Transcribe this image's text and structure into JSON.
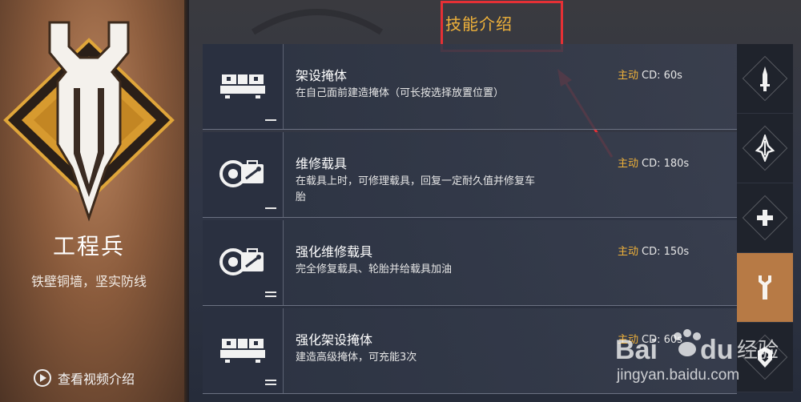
{
  "class_panel": {
    "name": "工程兵",
    "slogan": "铁壁铜墙，坚实防线",
    "video_link": "查看视频介绍"
  },
  "section_title": "技能介绍",
  "skills": [
    {
      "name": "架设掩体",
      "description": "在自己面前建造掩体（可长按选择放置位置）",
      "type": "主动",
      "cd": "CD: 60s",
      "icon": "barrier-icon",
      "level_marks": 1
    },
    {
      "name": "维修载具",
      "description": "在载具上时，可修理载具，回复一定耐久值并修复车胎",
      "type": "主动",
      "cd": "CD: 180s",
      "icon": "repair-kit-icon",
      "level_marks": 1
    },
    {
      "name": "强化维修载具",
      "description": "完全修复载具、轮胎并给载具加油",
      "type": "主动",
      "cd": "CD: 150s",
      "icon": "repair-kit-icon",
      "level_marks": 2
    },
    {
      "name": "强化架设掩体",
      "description": "建造高级掩体，可充能3次",
      "type": "主动",
      "cd": "CD: 60s",
      "icon": "barrier-icon",
      "level_marks": 2
    }
  ],
  "side_tabs": [
    {
      "icon": "dagger-icon",
      "active": false
    },
    {
      "icon": "claw-icon",
      "active": false
    },
    {
      "icon": "medic-cross-icon",
      "active": false
    },
    {
      "icon": "wrench-icon",
      "active": true
    },
    {
      "icon": "shield-icon",
      "active": false
    }
  ],
  "watermark": {
    "text": "jingyan.baidu.com",
    "logo": "Baidu 经验"
  },
  "colors": {
    "accent": "#f0b23a",
    "annotation": "#e53035",
    "active_tab": "#b77a45"
  }
}
